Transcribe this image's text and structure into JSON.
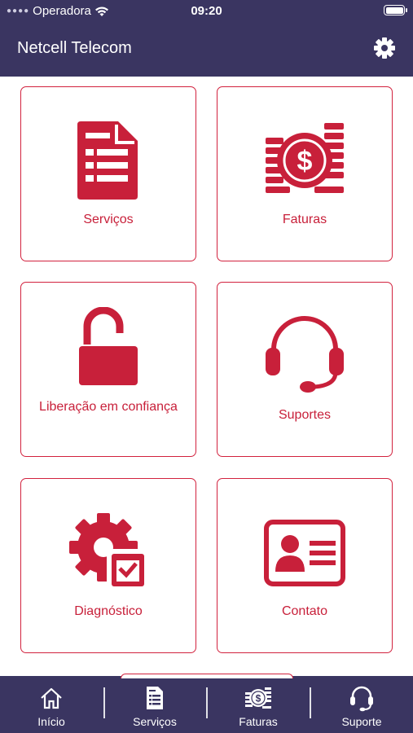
{
  "status_bar": {
    "carrier": "Operadora",
    "time": "09:20"
  },
  "header": {
    "title": "Netcell Telecom"
  },
  "tiles": [
    {
      "label": "Serviços",
      "icon": "document-list-icon"
    },
    {
      "label": "Faturas",
      "icon": "coins-dollar-icon"
    },
    {
      "label": "Liberação em confiança",
      "icon": "unlocked-padlock-icon"
    },
    {
      "label": "Suportes",
      "icon": "headset-icon"
    },
    {
      "label": "Diagnóstico",
      "icon": "gear-checklist-icon"
    },
    {
      "label": "Contato",
      "icon": "contact-card-icon"
    }
  ],
  "tab_bar": [
    {
      "label": "Início",
      "icon": "home-icon"
    },
    {
      "label": "Serviços",
      "icon": "document-list-icon"
    },
    {
      "label": "Faturas",
      "icon": "coins-dollar-icon"
    },
    {
      "label": "Suporte",
      "icon": "headset-icon"
    }
  ],
  "colors": {
    "navbar": "#3a3561",
    "accent": "#c8203a"
  }
}
